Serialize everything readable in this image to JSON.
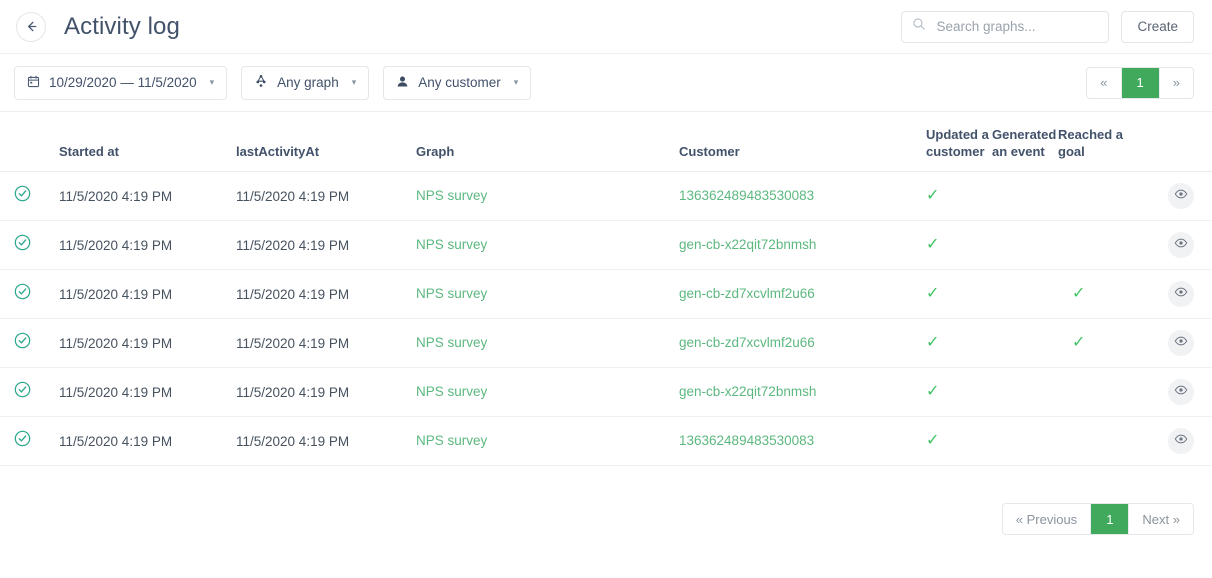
{
  "header": {
    "back_icon": "arrow-left-icon",
    "title": "Activity log",
    "search": {
      "icon": "search-icon",
      "placeholder": "Search graphs...",
      "value": ""
    },
    "create_label": "Create"
  },
  "filters": {
    "date_range": {
      "icon": "calendar-icon",
      "label": "10/29/2020 — 11/5/2020",
      "caret": "▾"
    },
    "graph": {
      "icon": "sitemap-icon",
      "label": "Any graph",
      "caret": "▾"
    },
    "customer": {
      "icon": "user-icon",
      "label": "Any customer",
      "caret": "▾"
    }
  },
  "pagination_top": {
    "prev_label": "«",
    "page_label": "1",
    "next_label": "»"
  },
  "pagination_bottom": {
    "prev_label": "« Previous",
    "page_label": "1",
    "next_label": "Next »"
  },
  "table": {
    "columns": {
      "status": "",
      "started_at": "Started at",
      "last_activity_at": "lastActivityAt",
      "graph": "Graph",
      "customer": "Customer",
      "updated_a_customer": "Updated a customer",
      "generated_an_event": "Generated an event",
      "reached_a_goal": "Reached a goal",
      "action": ""
    },
    "check_glyph": "✓",
    "status_icon": "check-circle-icon",
    "action_icon": "eye-icon",
    "rows": [
      {
        "status": "completed",
        "started_at": "11/5/2020 4:19 PM",
        "last_activity_at": "11/5/2020 4:19 PM",
        "graph": "NPS survey",
        "customer": "136362489483530083",
        "updated_a_customer": true,
        "generated_an_event": false,
        "reached_a_goal": false
      },
      {
        "status": "completed",
        "started_at": "11/5/2020 4:19 PM",
        "last_activity_at": "11/5/2020 4:19 PM",
        "graph": "NPS survey",
        "customer": "gen-cb-x22qit72bnmsh",
        "updated_a_customer": true,
        "generated_an_event": false,
        "reached_a_goal": false
      },
      {
        "status": "completed",
        "started_at": "11/5/2020 4:19 PM",
        "last_activity_at": "11/5/2020 4:19 PM",
        "graph": "NPS survey",
        "customer": "gen-cb-zd7xcvlmf2u66",
        "updated_a_customer": true,
        "generated_an_event": false,
        "reached_a_goal": true
      },
      {
        "status": "completed",
        "started_at": "11/5/2020 4:19 PM",
        "last_activity_at": "11/5/2020 4:19 PM",
        "graph": "NPS survey",
        "customer": "gen-cb-zd7xcvlmf2u66",
        "updated_a_customer": true,
        "generated_an_event": false,
        "reached_a_goal": true
      },
      {
        "status": "completed",
        "started_at": "11/5/2020 4:19 PM",
        "last_activity_at": "11/5/2020 4:19 PM",
        "graph": "NPS survey",
        "customer": "gen-cb-x22qit72bnmsh",
        "updated_a_customer": true,
        "generated_an_event": false,
        "reached_a_goal": false
      },
      {
        "status": "completed",
        "started_at": "11/5/2020 4:19 PM",
        "last_activity_at": "11/5/2020 4:19 PM",
        "graph": "NPS survey",
        "customer": "136362489483530083",
        "updated_a_customer": true,
        "generated_an_event": false,
        "reached_a_goal": false
      }
    ]
  },
  "colors": {
    "accent_green": "#40a95c",
    "link_green": "#5cb87f",
    "check_green": "#3fc463",
    "status_teal": "#2aa78c",
    "text": "#42526b"
  }
}
